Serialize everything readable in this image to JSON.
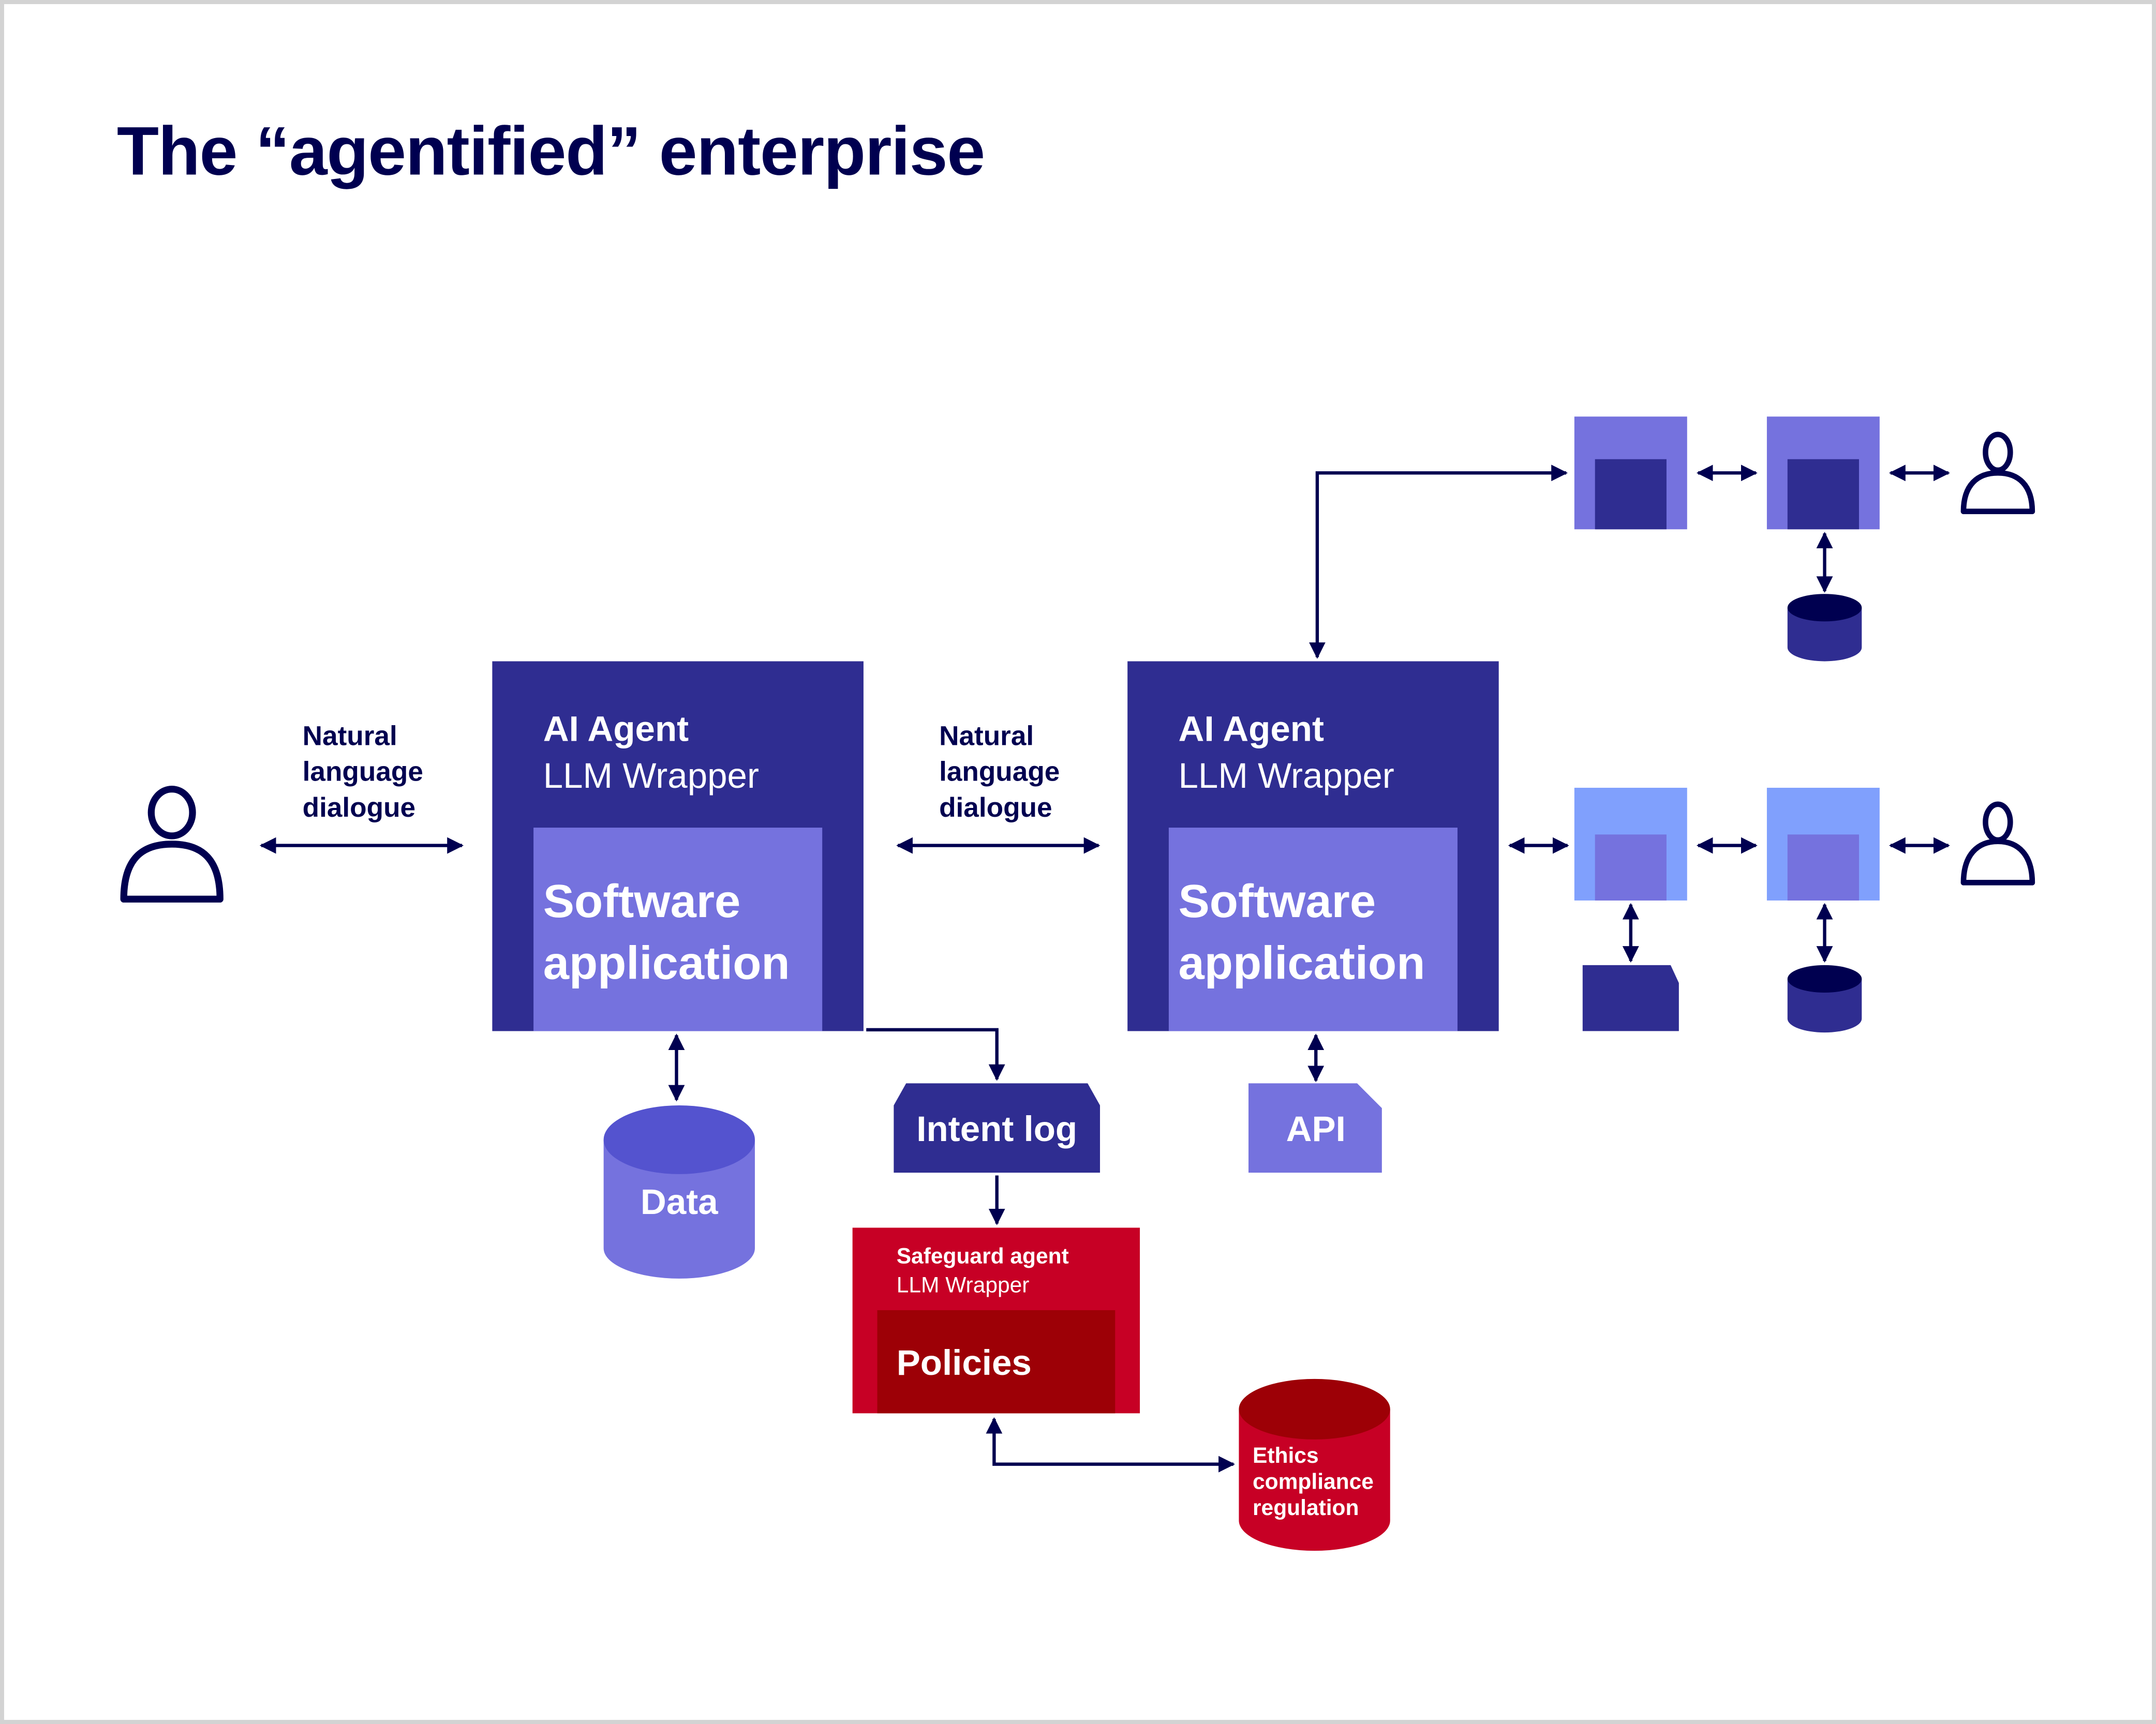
{
  "title": "The “agentified” enterprise",
  "colors": {
    "ink": "#000050",
    "agent_dark": "#2f2d91",
    "agent_mid": "#7572de",
    "node_light": "#80a0fd",
    "data_top": "#5453cf",
    "safeguard": "#c70025",
    "safeguard_dark": "#9d0006",
    "frame": "#d3d3d3"
  },
  "people": [
    {
      "id": "user-left",
      "icon": "person-icon"
    },
    {
      "id": "user-top-right",
      "icon": "person-icon"
    },
    {
      "id": "user-mid-right",
      "icon": "person-icon"
    }
  ],
  "dialogue_labels": [
    {
      "lines": [
        "Natural",
        "language",
        "dialogue"
      ]
    },
    {
      "lines": [
        "Natural",
        "language",
        "dialogue"
      ]
    }
  ],
  "agents": [
    {
      "title": "AI Agent",
      "subtitle": "LLM Wrapper",
      "inner_lines": [
        "Software",
        "application"
      ]
    },
    {
      "title": "AI Agent",
      "subtitle": "LLM Wrapper",
      "inner_lines": [
        "Software",
        "application"
      ]
    }
  ],
  "data_store": {
    "label": "Data",
    "icon": "database-icon"
  },
  "intent_log": {
    "label": "Intent log",
    "icon": "log-icon"
  },
  "api": {
    "label": "API",
    "icon": "api-icon"
  },
  "safeguard": {
    "title": "Safeguard agent",
    "subtitle": "LLM Wrapper",
    "inner_label": "Policies"
  },
  "ethics_store": {
    "lines": [
      "Ethics",
      "compliance",
      "regulation"
    ],
    "icon": "database-icon"
  },
  "downstream": {
    "top_row": [
      "agent-node",
      "agent-node",
      "database"
    ],
    "mid_row": [
      "agent-node",
      "agent-node",
      "document",
      "database"
    ]
  }
}
